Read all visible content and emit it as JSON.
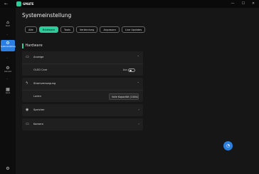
{
  "app": {
    "name": "GMATE"
  },
  "window": {
    "minimize": "—",
    "maximize": "☐",
    "close": "✕"
  },
  "sidebar": {
    "items": [
      {
        "label": "Start",
        "icon": "home-icon"
      },
      {
        "label": "Systemeinstellung",
        "icon": "gear-icon"
      },
      {
        "label": "Genesis",
        "icon": "gear-icon"
      },
      {
        "label": "Apps",
        "icon": "apps-icon"
      }
    ],
    "bottom_icon": "settings-icon"
  },
  "page": {
    "title": "Systemeinstellung"
  },
  "tabs": [
    {
      "label": "Alle",
      "active": false
    },
    {
      "label": "Hardware",
      "active": true
    },
    {
      "label": "Tools",
      "active": false
    },
    {
      "label": "Verbindung",
      "active": false
    },
    {
      "label": "Anpassen",
      "active": false
    },
    {
      "label": "Live Updates",
      "active": false
    }
  ],
  "section": {
    "title": "Hardware"
  },
  "cards": {
    "anzeige": {
      "label": "Anzeige",
      "icon": "monitor-icon",
      "sub": {
        "label": "OLED Care",
        "toggle_text": "Aus",
        "toggle_on": false
      }
    },
    "stromversorgung": {
      "label": "Stromversorgung",
      "icon": "power-icon",
      "sub": {
        "label": "Laden",
        "dropdown_value": "Volle Kapazität (100%)"
      }
    },
    "speicher": {
      "label": "Speicher",
      "icon": "disk-icon"
    },
    "kamera": {
      "label": "Kamera",
      "icon": "camera-icon"
    }
  },
  "colors": {
    "accent": "#2ecc9a",
    "active_nav": "#2a7fe0"
  }
}
